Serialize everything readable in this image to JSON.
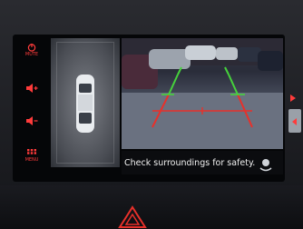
{
  "camera": {
    "warning_text": "Check surroundings for safety."
  },
  "sidebar": {
    "buttons": [
      {
        "icon": "power-icon",
        "label": "MUTE"
      },
      {
        "icon": "volume-up-icon",
        "label": ""
      },
      {
        "icon": "volume-down-icon",
        "label": ""
      },
      {
        "icon": "menu-icon",
        "label": "MENU"
      }
    ]
  },
  "colors": {
    "accent_red": "#ff3b3b",
    "guide_green": "#46d23c",
    "guide_red": "#e8302a",
    "guide_yellow": "#d8d432"
  }
}
